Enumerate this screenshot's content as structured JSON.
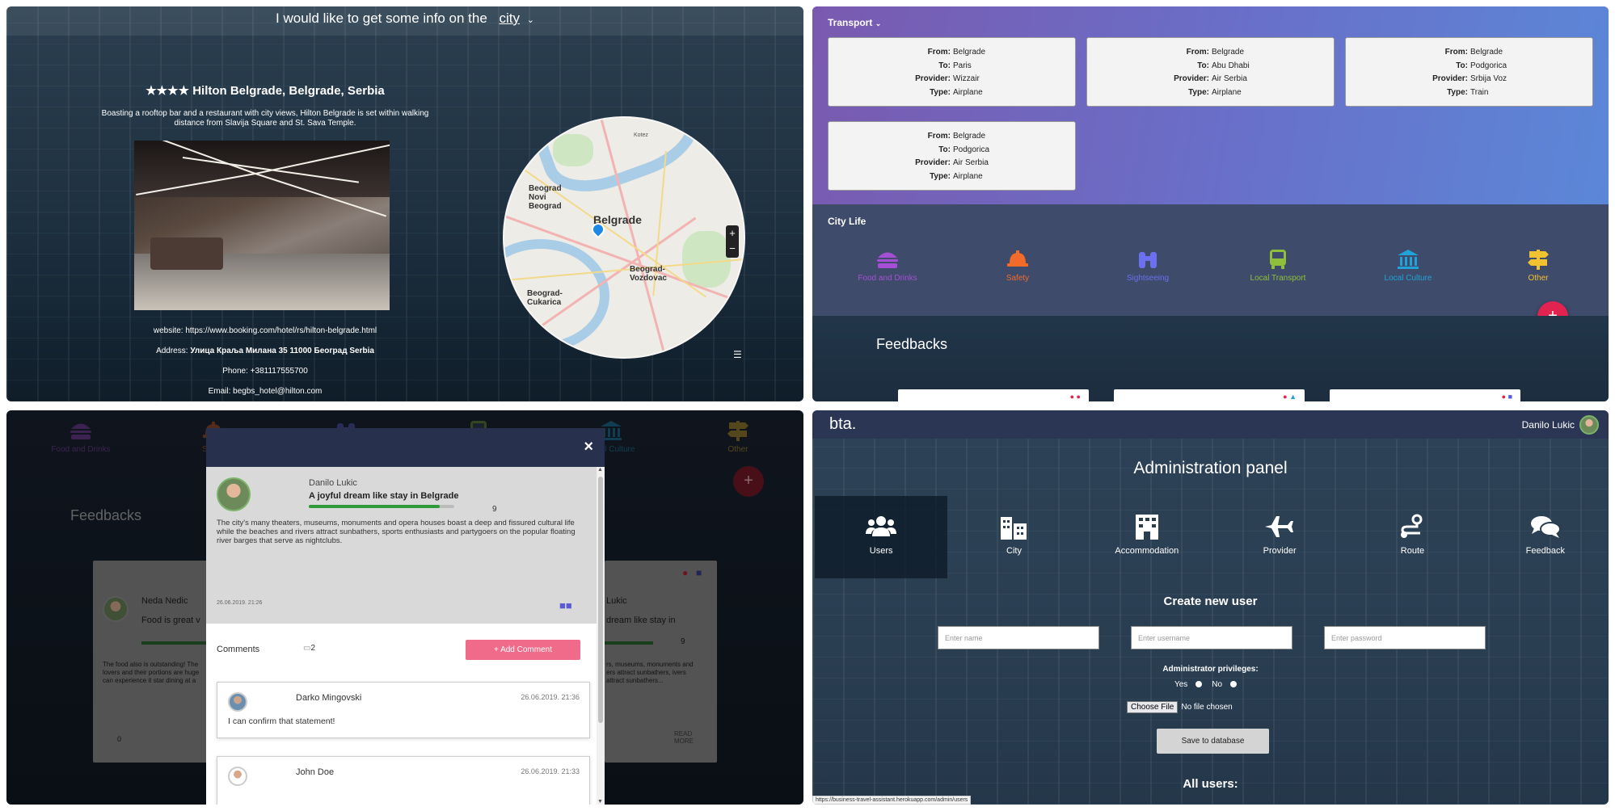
{
  "hotel": {
    "header_prefix": "I would like to get some info on the",
    "header_city": "city",
    "title": "★★★★ Hilton Belgrade, Belgrade, Serbia",
    "description": "Boasting a rooftop bar and a restaurant with city views, Hilton Belgrade is set within walking distance from Slavija Square and St. Sava Temple.",
    "website": "website: https://www.booking.com/hotel/rs/hilton-belgrade.html",
    "address_label": "Address:",
    "address_value": "Улица Краља Милана 35 11000 Београд Serbia",
    "phone": "Phone: +381117555700",
    "email": "Email: begbs_hotel@hilton.com"
  },
  "map": {
    "city_label": "Belgrade",
    "labels": [
      "Beograd Novi Beograd",
      "Beograd-Vozdovac",
      "Beograd-Cukarica",
      "Kotez"
    ]
  },
  "transport": {
    "heading": "Transport",
    "labels": {
      "from": "From:",
      "to": "To:",
      "provider": "Provider:",
      "type": "Type:"
    },
    "items": [
      {
        "from": "Belgrade",
        "to": "Paris",
        "provider": "Wizzair",
        "type": "Airplane"
      },
      {
        "from": "Belgrade",
        "to": "Abu Dhabi",
        "provider": "Air Serbia",
        "type": "Airplane"
      },
      {
        "from": "Belgrade",
        "to": "Podgorica",
        "provider": "Srbija Voz",
        "type": "Train"
      },
      {
        "from": "Belgrade",
        "to": "Podgorica",
        "provider": "Air Serbia",
        "type": "Airplane"
      }
    ]
  },
  "city_life": {
    "heading": "City Life",
    "categories": [
      {
        "label": "Food and Drinks",
        "icon": "burger-icon",
        "color": "#a64fd6"
      },
      {
        "label": "Safety",
        "icon": "helmet-icon",
        "color": "#f36b2a"
      },
      {
        "label": "Sightseeing",
        "icon": "binoculars-icon",
        "color": "#6b6ff0"
      },
      {
        "label": "Local Transport",
        "icon": "bus-icon",
        "color": "#8fbf3b"
      },
      {
        "label": "Local Culture",
        "icon": "museum-icon",
        "color": "#1fa3d8"
      },
      {
        "label": "Other",
        "icon": "signpost-icon",
        "color": "#f2c230"
      }
    ],
    "add_label": "+",
    "feedbacks_heading": "Feedbacks"
  },
  "feedback_modal": {
    "close_label": "×",
    "post": {
      "author": "Danilo Lukic",
      "title": "A joyful dream like stay in Belgrade",
      "rating": 9,
      "rating_max": 10,
      "body": "The city's many theaters, museums, monuments and opera houses boast a deep and fissured cultural life while the beaches and rivers attract sunbathers, sports enthusiasts and partygoers on the popular floating river barges that serve as nightclubs.",
      "date": "26.06.2019. 21:26"
    },
    "comments_label": "Comments",
    "comments_count": "2",
    "add_comment_label": "+ Add Comment",
    "comments": [
      {
        "name": "Darko Mingovski",
        "time": "26.06.2019. 21:36",
        "text": "I can confirm that statement!"
      },
      {
        "name": "John Doe",
        "time": "26.06.2019. 21:33",
        "text": ""
      }
    ],
    "background_cards": [
      {
        "author": "Neda Nedic",
        "snippet": "Food is great v",
        "body": "The food also is outstanding! The lovers and their portions are huge can experience it star dining at a",
        "count": "0"
      },
      {
        "author": "Lukic",
        "snippet": "dream like stay in",
        "body": "rs, museums, monuments and ers attract sunbathers, ivers attract sunbathers...",
        "read_more": "READ MORE",
        "score": "9"
      }
    ]
  },
  "admin": {
    "brand": "bta.",
    "user_name": "Danilo Lukic",
    "title": "Administration panel",
    "tabs": [
      {
        "label": "Users",
        "icon": "users-icon"
      },
      {
        "label": "City",
        "icon": "city-icon"
      },
      {
        "label": "Accommodation",
        "icon": "building-icon"
      },
      {
        "label": "Provider",
        "icon": "airplane-icon"
      },
      {
        "label": "Route",
        "icon": "route-icon"
      },
      {
        "label": "Feedback",
        "icon": "comments-icon"
      }
    ],
    "active_tab": "Users",
    "create_heading": "Create new user",
    "name_placeholder": "Enter name",
    "username_placeholder": "Enter username",
    "password_placeholder": "Enter password",
    "privileges_label": "Administrator privileges:",
    "yes_label": "Yes",
    "no_label": "No",
    "file_button": "Choose File",
    "file_status": "No file chosen",
    "save_label": "Save to database",
    "all_users_heading": "All users:",
    "status_url": "https://business-travel-assistant.herokuapp.com/admin/users"
  }
}
